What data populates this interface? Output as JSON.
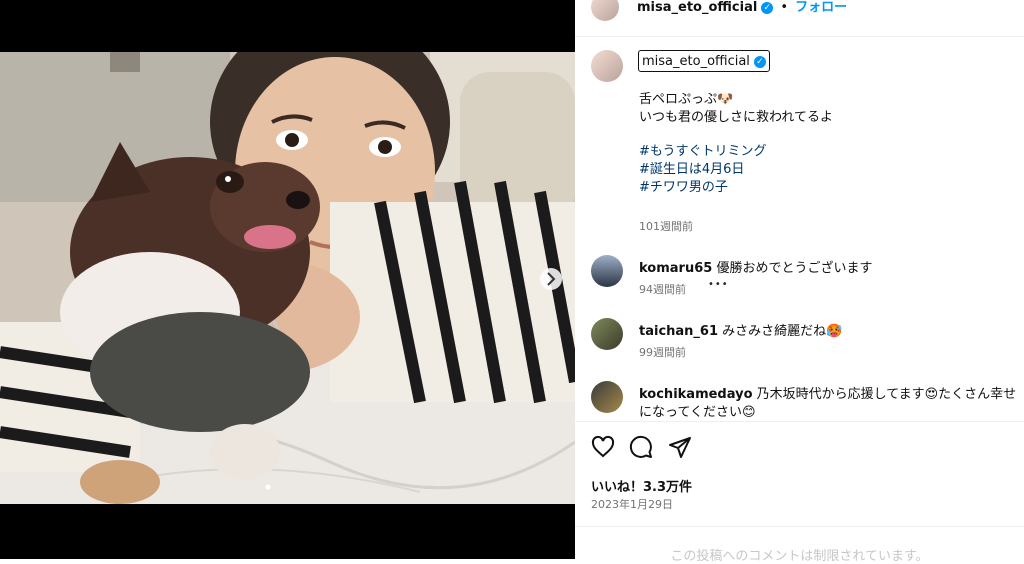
{
  "header": {
    "username": "misa_eto_official",
    "separator": "•",
    "follow_label": "フォロー"
  },
  "caption": {
    "username": "misa_eto_official",
    "line1": "舌ペロぷっぷ🐶",
    "line2": "いつも君の優しさに救われてるよ",
    "hashtags": [
      "#もうすぐトリミング",
      "#誕生日は4月6日",
      "#チワワ男の子"
    ],
    "time": "101週間前"
  },
  "comments": [
    {
      "username": "komaru65",
      "text": "優勝おめでとうございます",
      "time": "94週間前",
      "more": "•••"
    },
    {
      "username": "taichan_61",
      "text": "みさみさ綺麗だね🥵",
      "time": "99週間前"
    },
    {
      "username": "kochikamedayo",
      "text": "乃木坂時代から応援してます😍たくさん幸せ",
      "text2": "になってください😊"
    }
  ],
  "actions": {
    "like_icon": "heart-icon",
    "comment_icon": "comment-icon",
    "share_icon": "send-icon"
  },
  "likes_label": "いいね！3.3万件",
  "post_date": "2023年1月29日",
  "comments_restricted": "この投稿へのコメントは制限されています。",
  "colors": {
    "link": "#00376b",
    "follow": "#0095f6",
    "verified": "#0095f6"
  }
}
